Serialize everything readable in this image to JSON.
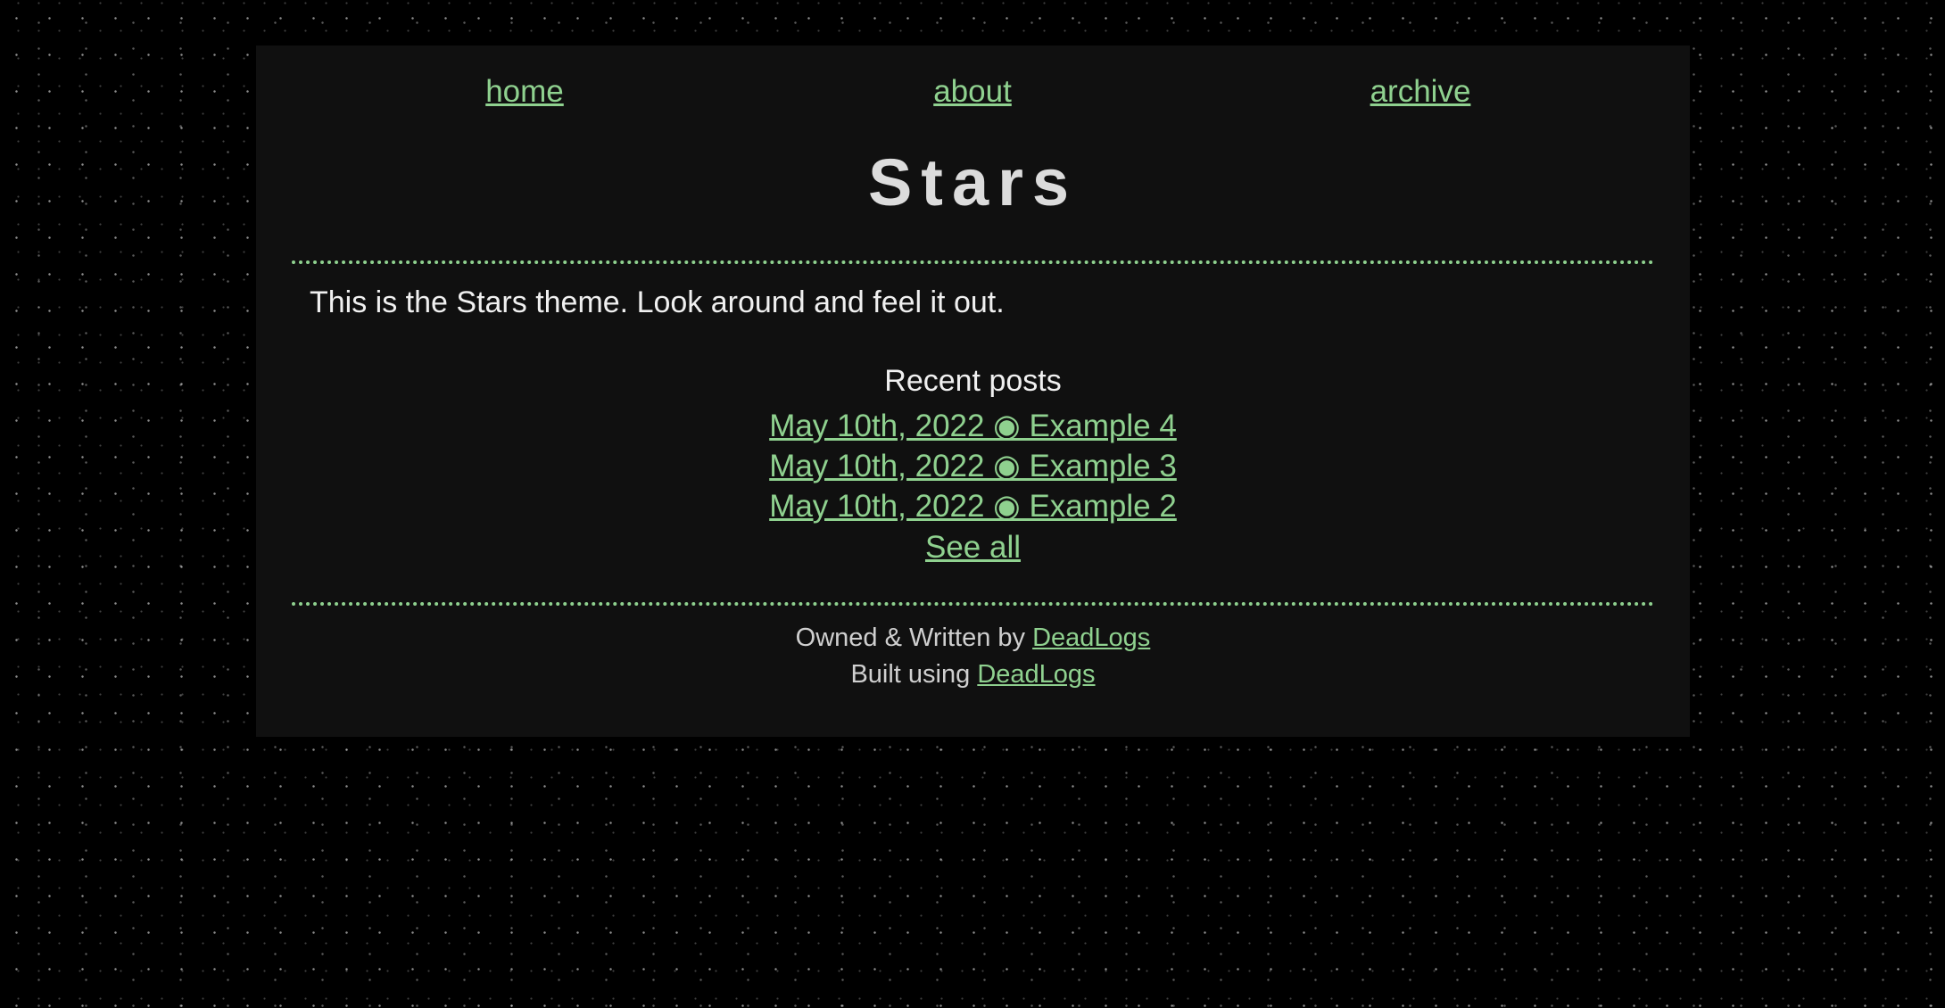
{
  "nav": {
    "items": [
      "home",
      "about",
      "archive"
    ]
  },
  "header": {
    "title": "Stars"
  },
  "intro": {
    "text": "This is the Stars theme. Look around and feel it out."
  },
  "recent_posts": {
    "heading": "Recent posts",
    "posts": [
      "May 10th, 2022 ◉ Example 4",
      "May 10th, 2022 ◉ Example 3",
      "May 10th, 2022 ◉ Example 2"
    ],
    "see_all_label": "See all"
  },
  "footer": {
    "owned_prefix": "Owned & Written by",
    "owned_link": "DeadLogs",
    "built_prefix": "Built using",
    "built_link": "DeadLogs"
  },
  "colors": {
    "background": "#000000",
    "panel": "#101010",
    "accent": "#8fd18f",
    "text": "#f0f0f0",
    "title": "#dcdcdc"
  }
}
